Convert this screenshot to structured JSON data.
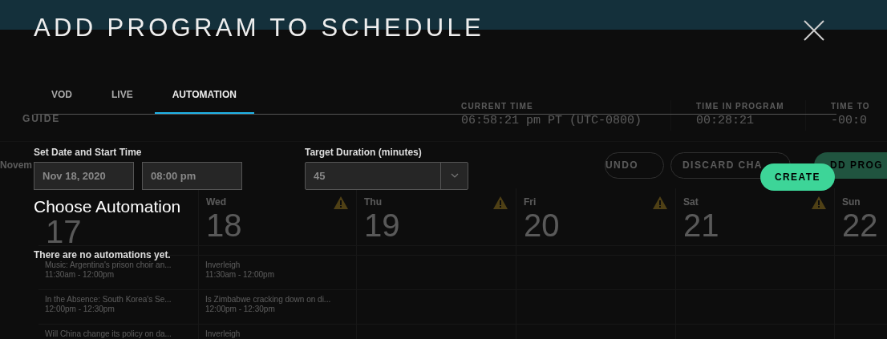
{
  "background_page": {
    "section_label": "GUIDE",
    "stats": [
      {
        "label": "CURRENT TIME",
        "value": "06:58:21 pm PT (UTC-0800)"
      },
      {
        "label": "TIME IN PROGRAM",
        "value": "00:28:21"
      },
      {
        "label": "TIME TO",
        "value": "-00:0"
      }
    ],
    "month_label": "Novem",
    "actions": [
      {
        "label": "UNDO",
        "kind": "outline"
      },
      {
        "label": "DISCARD CHA",
        "kind": "outline"
      },
      {
        "label": "DD PROG",
        "kind": "filled"
      }
    ],
    "days": [
      {
        "day": "17",
        "warning": false,
        "events": [
          {
            "title": "Music: Argentina's prison choir an...",
            "time": "11:30am - 12:00pm"
          },
          {
            "title": "In the Absence: South Korea's Se...",
            "time": "12:00pm - 12:30pm"
          },
          {
            "title": "Will China change its policy on da..."
          }
        ]
      },
      {
        "weekday": "Wed",
        "day": "18",
        "warning": true,
        "events": [
          {
            "title": "Inverleigh",
            "time": "11:30am - 12:00pm"
          },
          {
            "title": "Is Zimbabwe cracking down on di...",
            "time": "12:00pm - 12:30pm"
          },
          {
            "title": "Inverleigh"
          }
        ]
      },
      {
        "weekday": "Thu",
        "day": "19",
        "warning": true
      },
      {
        "weekday": "Fri",
        "day": "20",
        "warning": true
      },
      {
        "weekday": "Sat",
        "day": "21",
        "warning": true
      },
      {
        "weekday": "Sun",
        "day": "22",
        "warning": false
      }
    ]
  },
  "dialog": {
    "title": "ADD PROGRAM TO SCHEDULE",
    "tabs": [
      {
        "label": "VOD",
        "selected": false
      },
      {
        "label": "LIVE",
        "selected": false
      },
      {
        "label": "AUTOMATION",
        "selected": true
      }
    ],
    "start": {
      "label": "Set Date and Start Time",
      "date": "Nov 18, 2020",
      "time": "08:00 pm"
    },
    "duration": {
      "label": "Target Duration (minutes)",
      "value": "45"
    },
    "create_button": "CREATE",
    "section_title": "Choose Automation",
    "empty_message": "There are no automations yet."
  }
}
